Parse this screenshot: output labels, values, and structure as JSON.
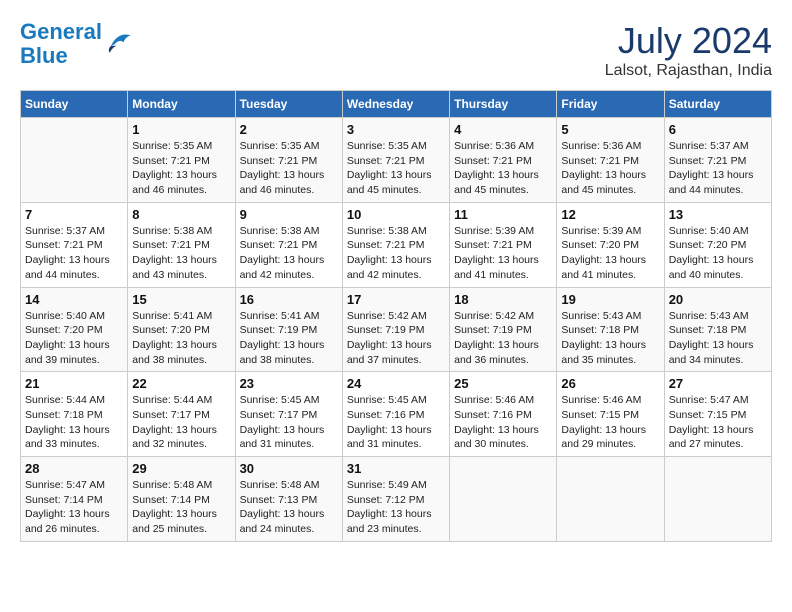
{
  "header": {
    "logo_line1": "General",
    "logo_line2": "Blue",
    "month_year": "July 2024",
    "location": "Lalsot, Rajasthan, India"
  },
  "columns": [
    "Sunday",
    "Monday",
    "Tuesday",
    "Wednesday",
    "Thursday",
    "Friday",
    "Saturday"
  ],
  "weeks": [
    [
      {
        "day": "",
        "info": ""
      },
      {
        "day": "1",
        "info": "Sunrise: 5:35 AM\nSunset: 7:21 PM\nDaylight: 13 hours\nand 46 minutes."
      },
      {
        "day": "2",
        "info": "Sunrise: 5:35 AM\nSunset: 7:21 PM\nDaylight: 13 hours\nand 46 minutes."
      },
      {
        "day": "3",
        "info": "Sunrise: 5:35 AM\nSunset: 7:21 PM\nDaylight: 13 hours\nand 45 minutes."
      },
      {
        "day": "4",
        "info": "Sunrise: 5:36 AM\nSunset: 7:21 PM\nDaylight: 13 hours\nand 45 minutes."
      },
      {
        "day": "5",
        "info": "Sunrise: 5:36 AM\nSunset: 7:21 PM\nDaylight: 13 hours\nand 45 minutes."
      },
      {
        "day": "6",
        "info": "Sunrise: 5:37 AM\nSunset: 7:21 PM\nDaylight: 13 hours\nand 44 minutes."
      }
    ],
    [
      {
        "day": "7",
        "info": "Sunrise: 5:37 AM\nSunset: 7:21 PM\nDaylight: 13 hours\nand 44 minutes."
      },
      {
        "day": "8",
        "info": "Sunrise: 5:38 AM\nSunset: 7:21 PM\nDaylight: 13 hours\nand 43 minutes."
      },
      {
        "day": "9",
        "info": "Sunrise: 5:38 AM\nSunset: 7:21 PM\nDaylight: 13 hours\nand 42 minutes."
      },
      {
        "day": "10",
        "info": "Sunrise: 5:38 AM\nSunset: 7:21 PM\nDaylight: 13 hours\nand 42 minutes."
      },
      {
        "day": "11",
        "info": "Sunrise: 5:39 AM\nSunset: 7:21 PM\nDaylight: 13 hours\nand 41 minutes."
      },
      {
        "day": "12",
        "info": "Sunrise: 5:39 AM\nSunset: 7:20 PM\nDaylight: 13 hours\nand 41 minutes."
      },
      {
        "day": "13",
        "info": "Sunrise: 5:40 AM\nSunset: 7:20 PM\nDaylight: 13 hours\nand 40 minutes."
      }
    ],
    [
      {
        "day": "14",
        "info": "Sunrise: 5:40 AM\nSunset: 7:20 PM\nDaylight: 13 hours\nand 39 minutes."
      },
      {
        "day": "15",
        "info": "Sunrise: 5:41 AM\nSunset: 7:20 PM\nDaylight: 13 hours\nand 38 minutes."
      },
      {
        "day": "16",
        "info": "Sunrise: 5:41 AM\nSunset: 7:19 PM\nDaylight: 13 hours\nand 38 minutes."
      },
      {
        "day": "17",
        "info": "Sunrise: 5:42 AM\nSunset: 7:19 PM\nDaylight: 13 hours\nand 37 minutes."
      },
      {
        "day": "18",
        "info": "Sunrise: 5:42 AM\nSunset: 7:19 PM\nDaylight: 13 hours\nand 36 minutes."
      },
      {
        "day": "19",
        "info": "Sunrise: 5:43 AM\nSunset: 7:18 PM\nDaylight: 13 hours\nand 35 minutes."
      },
      {
        "day": "20",
        "info": "Sunrise: 5:43 AM\nSunset: 7:18 PM\nDaylight: 13 hours\nand 34 minutes."
      }
    ],
    [
      {
        "day": "21",
        "info": "Sunrise: 5:44 AM\nSunset: 7:18 PM\nDaylight: 13 hours\nand 33 minutes."
      },
      {
        "day": "22",
        "info": "Sunrise: 5:44 AM\nSunset: 7:17 PM\nDaylight: 13 hours\nand 32 minutes."
      },
      {
        "day": "23",
        "info": "Sunrise: 5:45 AM\nSunset: 7:17 PM\nDaylight: 13 hours\nand 31 minutes."
      },
      {
        "day": "24",
        "info": "Sunrise: 5:45 AM\nSunset: 7:16 PM\nDaylight: 13 hours\nand 31 minutes."
      },
      {
        "day": "25",
        "info": "Sunrise: 5:46 AM\nSunset: 7:16 PM\nDaylight: 13 hours\nand 30 minutes."
      },
      {
        "day": "26",
        "info": "Sunrise: 5:46 AM\nSunset: 7:15 PM\nDaylight: 13 hours\nand 29 minutes."
      },
      {
        "day": "27",
        "info": "Sunrise: 5:47 AM\nSunset: 7:15 PM\nDaylight: 13 hours\nand 27 minutes."
      }
    ],
    [
      {
        "day": "28",
        "info": "Sunrise: 5:47 AM\nSunset: 7:14 PM\nDaylight: 13 hours\nand 26 minutes."
      },
      {
        "day": "29",
        "info": "Sunrise: 5:48 AM\nSunset: 7:14 PM\nDaylight: 13 hours\nand 25 minutes."
      },
      {
        "day": "30",
        "info": "Sunrise: 5:48 AM\nSunset: 7:13 PM\nDaylight: 13 hours\nand 24 minutes."
      },
      {
        "day": "31",
        "info": "Sunrise: 5:49 AM\nSunset: 7:12 PM\nDaylight: 13 hours\nand 23 minutes."
      },
      {
        "day": "",
        "info": ""
      },
      {
        "day": "",
        "info": ""
      },
      {
        "day": "",
        "info": ""
      }
    ]
  ]
}
